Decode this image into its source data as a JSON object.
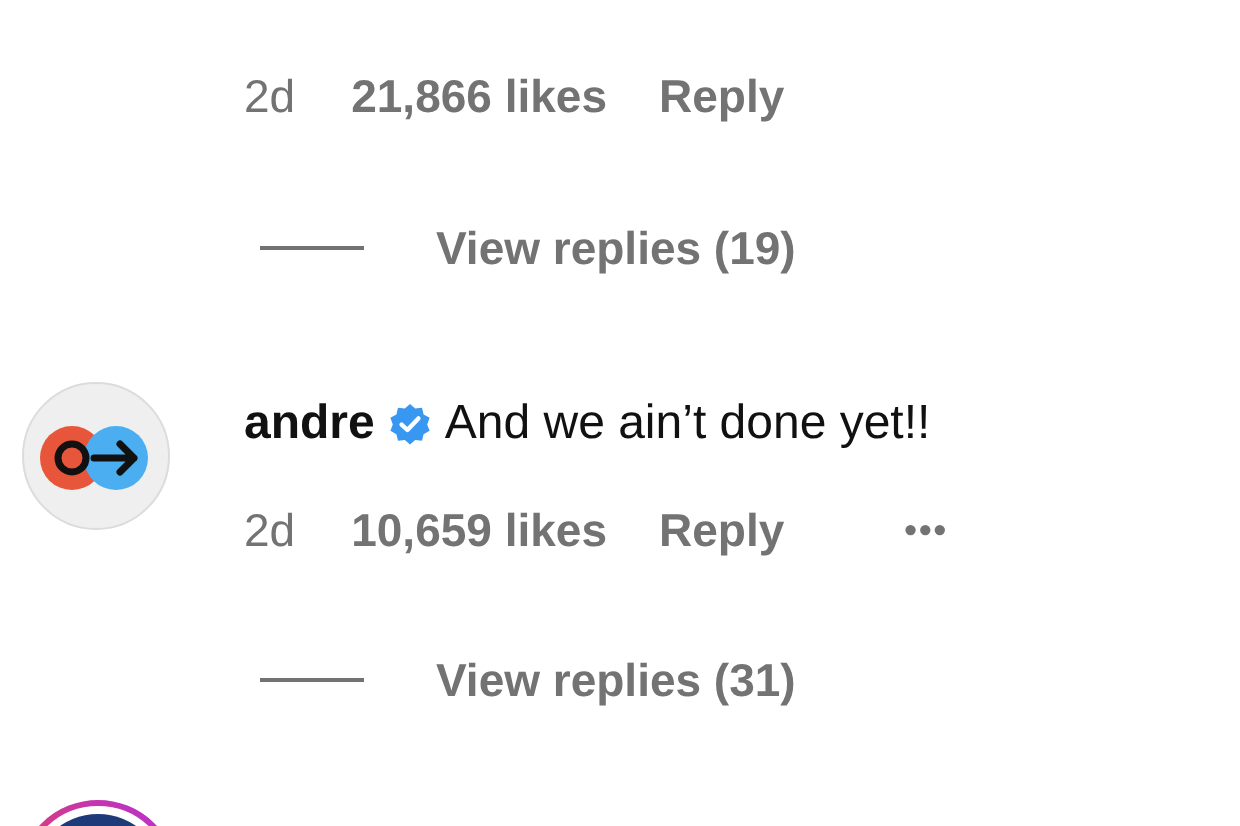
{
  "comments": [
    {
      "kind": "tail",
      "time": "2d",
      "likes": "21,866 likes",
      "reply": "Reply",
      "view_replies": "View replies (19)"
    },
    {
      "kind": "full",
      "username": "andre",
      "verified": true,
      "text": "And we ain’t done yet!!",
      "time": "2d",
      "likes": "10,659 likes",
      "reply": "Reply",
      "more": "•••",
      "view_replies": "View replies (31)"
    },
    {
      "kind": "avatar_only"
    }
  ]
}
